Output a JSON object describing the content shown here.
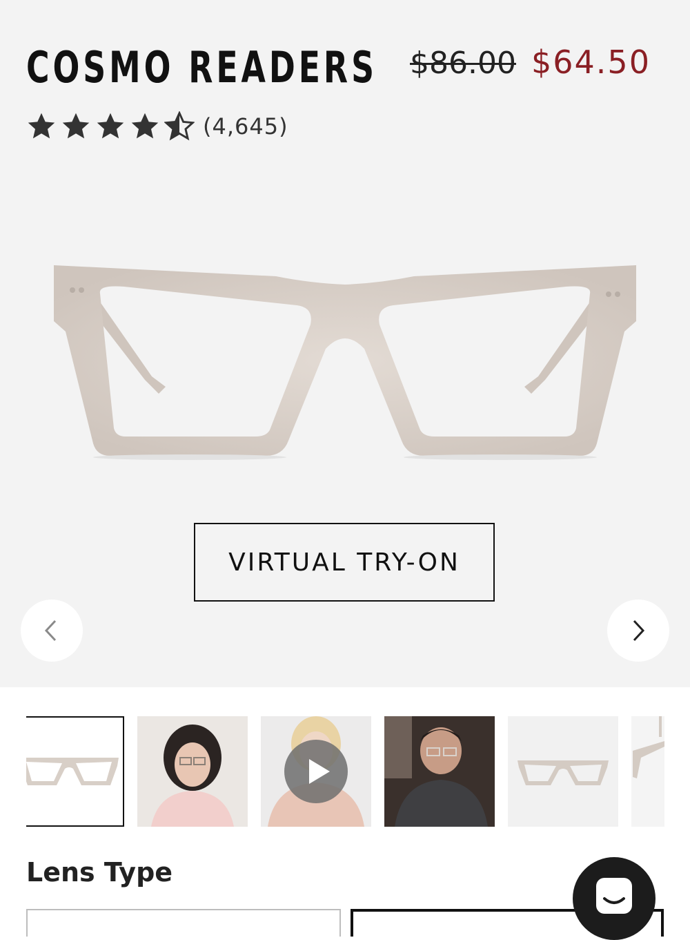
{
  "product": {
    "title": "COSMO READERS",
    "price_original": "$86.00",
    "price_sale": "$64.50",
    "rating_value": 4.5,
    "rating_max": 5,
    "review_count": "(4,645)"
  },
  "actions": {
    "virtual_try_on": "VIRTUAL TRY-ON"
  },
  "gallery": {
    "thumbnails": [
      {
        "kind": "product-front",
        "selected": true
      },
      {
        "kind": "model-woman-dark-hair"
      },
      {
        "kind": "video-woman-blonde"
      },
      {
        "kind": "model-man"
      },
      {
        "kind": "product-angle"
      },
      {
        "kind": "product-side-partial"
      }
    ]
  },
  "lens": {
    "section_title": "Lens Type"
  },
  "colors": {
    "sale_price": "#8a1f24",
    "frame": "#d8cfc7",
    "hero_background": "#f3f3f3"
  },
  "icons": {
    "prev": "chevron-left-icon",
    "next": "chevron-right-icon",
    "chat": "chat-bubble-icon",
    "play": "play-icon"
  }
}
